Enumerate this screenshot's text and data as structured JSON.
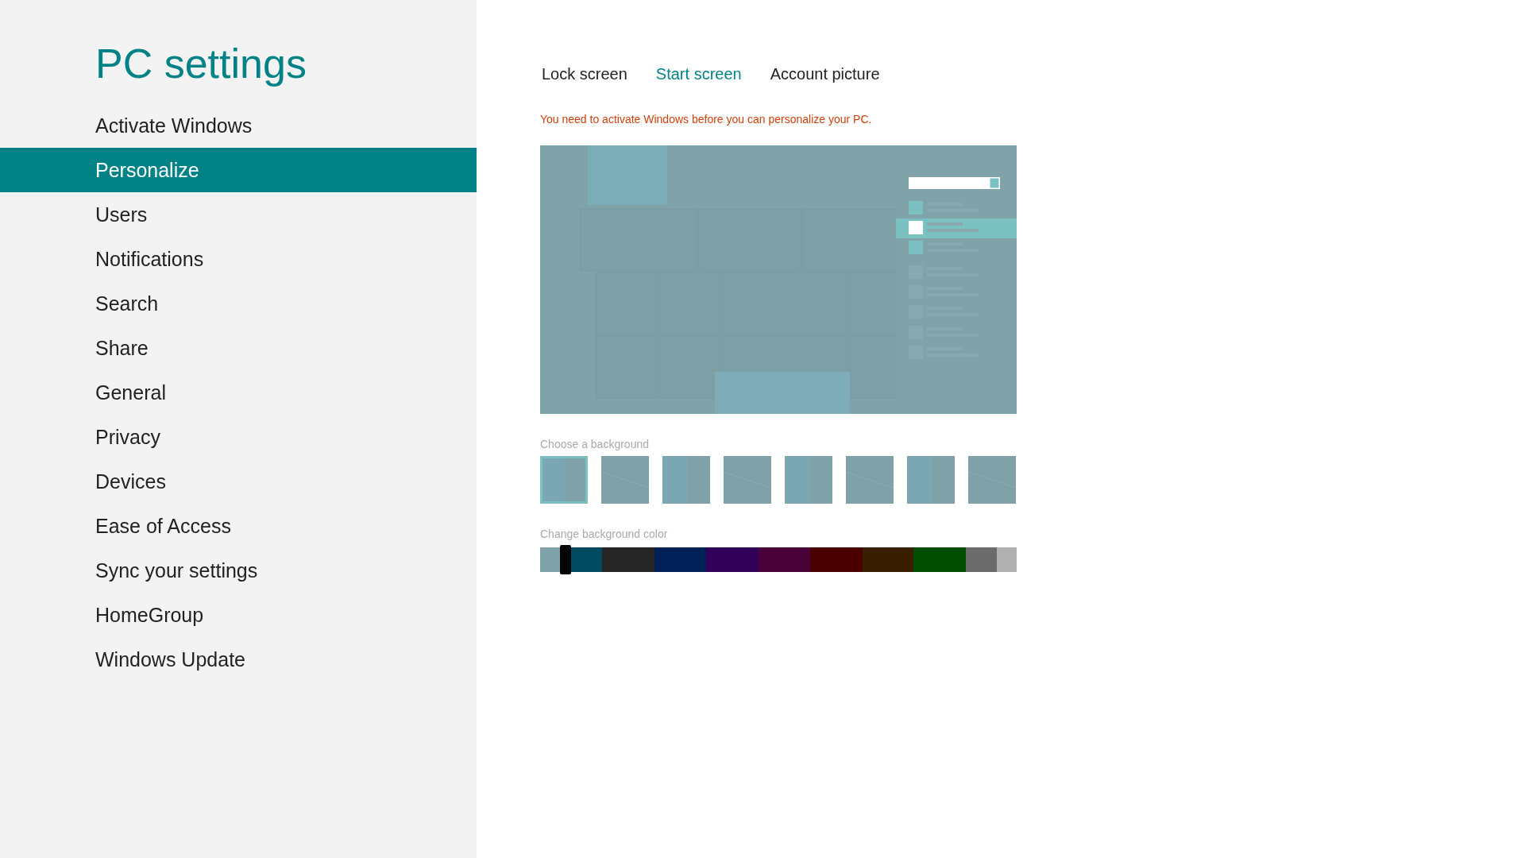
{
  "sidebar": {
    "title": "PC settings",
    "items": [
      {
        "label": "Activate Windows",
        "selected": false
      },
      {
        "label": "Personalize",
        "selected": true
      },
      {
        "label": "Users",
        "selected": false
      },
      {
        "label": "Notifications",
        "selected": false
      },
      {
        "label": "Search",
        "selected": false
      },
      {
        "label": "Share",
        "selected": false
      },
      {
        "label": "General",
        "selected": false
      },
      {
        "label": "Privacy",
        "selected": false
      },
      {
        "label": "Devices",
        "selected": false
      },
      {
        "label": "Ease of Access",
        "selected": false
      },
      {
        "label": "Sync your settings",
        "selected": false
      },
      {
        "label": "HomeGroup",
        "selected": false
      },
      {
        "label": "Windows Update",
        "selected": false
      }
    ]
  },
  "tabs": [
    {
      "label": "Lock screen",
      "selected": false
    },
    {
      "label": "Start screen",
      "selected": true
    },
    {
      "label": "Account picture",
      "selected": false
    }
  ],
  "warning": "You need to activate Windows before you can personalize your PC.",
  "backgrounds": {
    "label": "Choose a background",
    "items": [
      {
        "selected": true
      },
      {
        "selected": false
      },
      {
        "selected": false
      },
      {
        "selected": false
      },
      {
        "selected": false
      },
      {
        "selected": false
      },
      {
        "selected": false
      },
      {
        "selected": false
      }
    ]
  },
  "background_color": {
    "label": "Change background color",
    "level": 0.05,
    "segments": [
      {
        "color": "#7fa1a8"
      },
      {
        "color": "#004b5f"
      },
      {
        "color": "#262626"
      },
      {
        "color": "#002157"
      },
      {
        "color": "#310058"
      },
      {
        "color": "#4a0039"
      },
      {
        "color": "#4b0000"
      },
      {
        "color": "#381f00"
      },
      {
        "color": "#004d00"
      },
      {
        "color": "#6b6b6b"
      },
      {
        "color": "#b0b0b0"
      }
    ]
  }
}
